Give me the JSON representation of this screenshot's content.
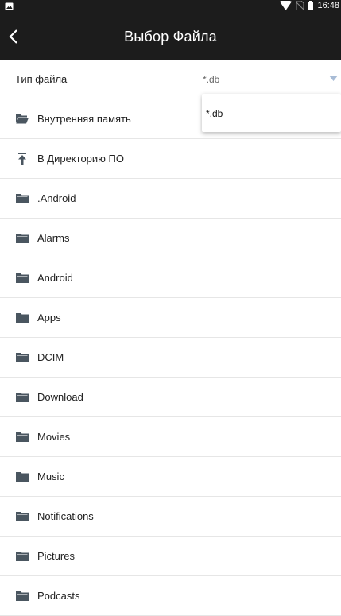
{
  "status_bar": {
    "time": "16:48",
    "icons": [
      "image-icon",
      "wifi-icon",
      "no-sim-icon",
      "battery-icon"
    ]
  },
  "toolbar": {
    "title": "Выбор Файла",
    "back_icon": "chevron-left-icon"
  },
  "file_type": {
    "label": "Тип файла",
    "value": "*.db",
    "options": [
      "*.db"
    ]
  },
  "items": [
    {
      "label": "Внутренняя память",
      "icon": "folder-open-icon"
    },
    {
      "label": "В Директорию ПО",
      "icon": "upload-arrow-icon"
    },
    {
      "label": ".Android",
      "icon": "folder-icon"
    },
    {
      "label": "Alarms",
      "icon": "folder-icon"
    },
    {
      "label": "Android",
      "icon": "folder-icon"
    },
    {
      "label": "Apps",
      "icon": "folder-icon"
    },
    {
      "label": "DCIM",
      "icon": "folder-icon"
    },
    {
      "label": "Download",
      "icon": "folder-icon"
    },
    {
      "label": "Movies",
      "icon": "folder-icon"
    },
    {
      "label": "Music",
      "icon": "folder-icon"
    },
    {
      "label": "Notifications",
      "icon": "folder-icon"
    },
    {
      "label": "Pictures",
      "icon": "folder-icon"
    },
    {
      "label": "Podcasts",
      "icon": "folder-icon"
    }
  ],
  "colors": {
    "toolbar_bg": "#1c1c1c",
    "folder_icon": "#4a5660",
    "divider": "#e6e6e6",
    "dropdown_arrow": "#a8bcd6"
  }
}
